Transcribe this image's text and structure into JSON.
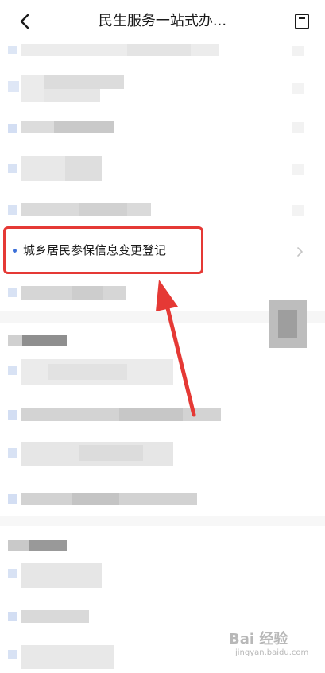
{
  "header": {
    "title": "民生服务一站式办..."
  },
  "highlighted_item": {
    "label": "城乡居民参保信息变更登记"
  },
  "watermark": {
    "main": "Bai 经验",
    "sub": "jingyan.baidu.com"
  },
  "colors": {
    "highlight_border": "#e53935",
    "arrow": "#e53935",
    "bullet": "#3b6fd8"
  },
  "icons": {
    "back": "chevron-left-icon",
    "bookmark": "bookmark-icon",
    "item_arrow": "chevron-right-icon"
  }
}
